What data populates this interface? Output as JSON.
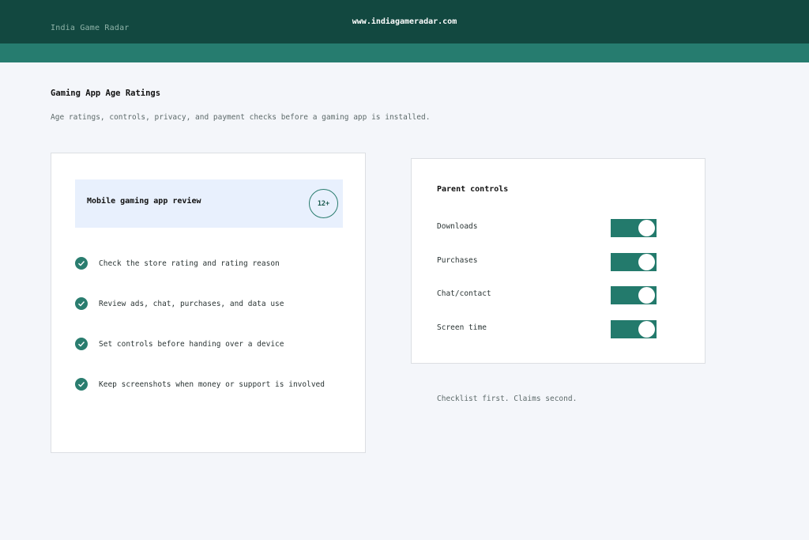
{
  "header": {
    "brand": "India Game Radar",
    "url": "www.indiagameradar.com"
  },
  "page": {
    "title": "Gaming App Age Ratings",
    "subtitle": "Age ratings, controls, privacy, and payment checks before a gaming app is installed."
  },
  "review": {
    "title": "Mobile gaming app review",
    "age_badge": "12+",
    "checklist": [
      "Check the store rating and rating reason",
      "Review ads, chat, purchases, and data use",
      "Set controls before handing over a device",
      "Keep screenshots when money or support is involved"
    ]
  },
  "controls": {
    "title": "Parent controls",
    "items": [
      {
        "label": "Downloads",
        "on": true
      },
      {
        "label": "Purchases",
        "on": true
      },
      {
        "label": "Chat/contact",
        "on": true
      },
      {
        "label": "Screen time",
        "on": true
      }
    ]
  },
  "footnote": "Checklist first. Claims second.",
  "colors": {
    "header_bg": "#124840",
    "band_bg": "#267c6f",
    "accent": "#2a7d6f",
    "review_box_bg": "#e8f0fd",
    "page_bg": "#f4f6fa"
  }
}
